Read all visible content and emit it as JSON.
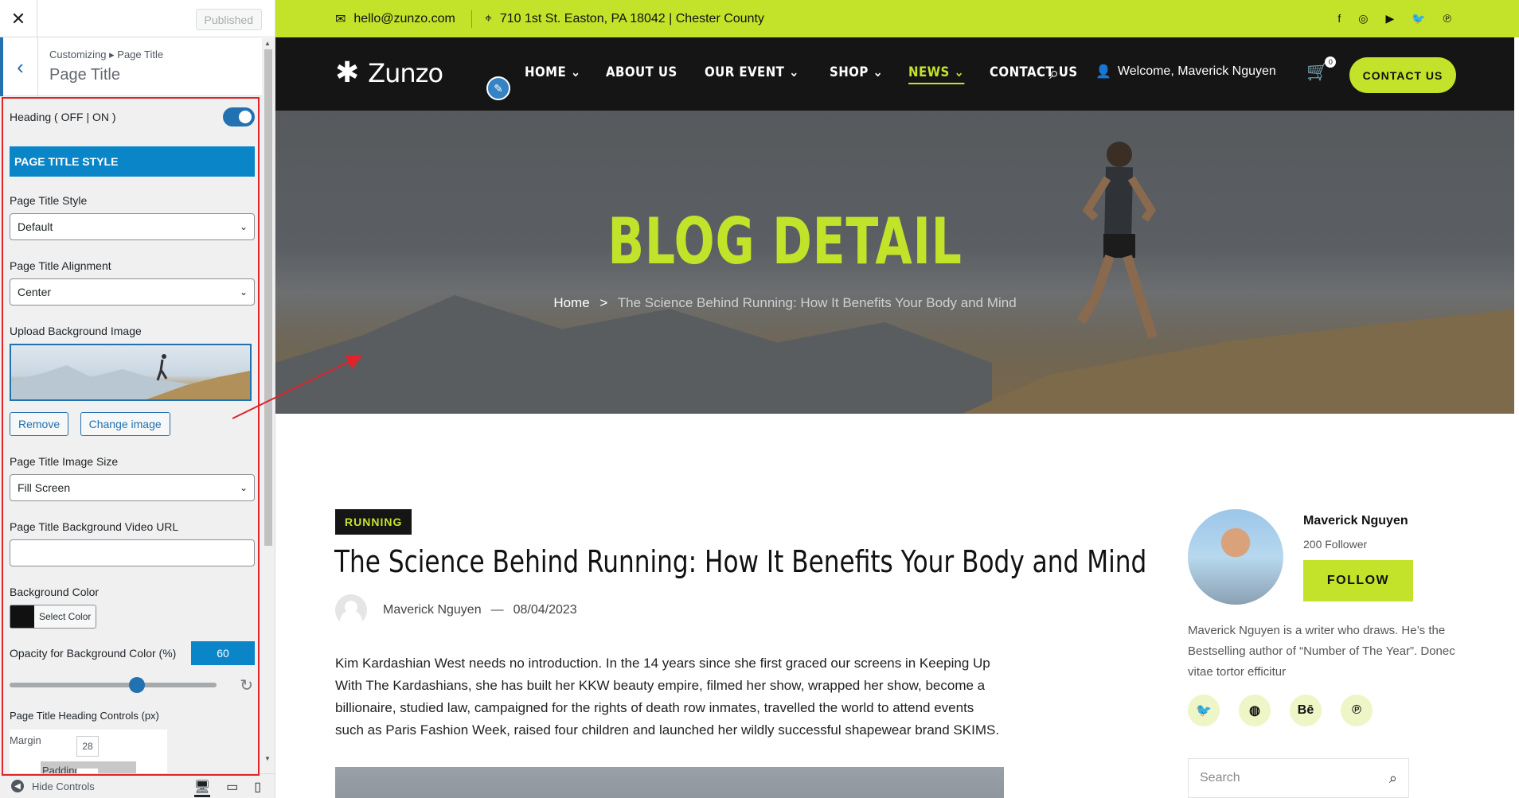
{
  "customizer": {
    "close_icon_glyph": "✕",
    "published_label": "Published",
    "breadcrumb": "Customizing ▸ Page Title",
    "section_title": "Page Title",
    "heading_toggle_label": "Heading ( OFF | ON )",
    "heading_toggle_on": true,
    "style_banner": "PAGE TITLE STYLE",
    "page_title_style_label": "Page Title Style",
    "page_title_style_value": "Default",
    "alignment_label": "Page Title Alignment",
    "alignment_value": "Center",
    "upload_bg_label": "Upload Background Image",
    "remove_label": "Remove",
    "change_image_label": "Change image",
    "image_size_label": "Page Title Image Size",
    "image_size_value": "Fill Screen",
    "video_url_label": "Page Title Background Video URL",
    "video_url_value": "",
    "bg_color_label": "Background Color",
    "bg_color_value": "#111111",
    "select_color_label": "Select Color",
    "opacity_label": "Opacity for Background Color (%)",
    "opacity_value": "60",
    "heading_controls_label": "Page Title Heading Controls (px)",
    "margin_label": "Margin",
    "margin_value": "28",
    "padding_label": "Padding",
    "padding_value": "-",
    "hide_controls_label": "Hide Controls"
  },
  "site": {
    "accent_color": "#c3e22a",
    "email": "hello@zunzo.com",
    "address": "710 1st St. Easton, PA 18042 | Chester County",
    "social_icons": [
      "facebook-icon",
      "instagram-icon",
      "youtube-icon",
      "twitter-icon",
      "pinterest-icon"
    ],
    "social_glyphs": [
      "f",
      "◎",
      "▶",
      "🐦",
      "℗"
    ],
    "logo_text": "Zunzo",
    "menu": [
      {
        "label": "HOME",
        "dropdown": true
      },
      {
        "label": "ABOUT US",
        "dropdown": false
      },
      {
        "label": "OUR EVENT",
        "dropdown": true
      },
      {
        "label": "SHOP",
        "dropdown": true
      },
      {
        "label": "NEWS",
        "dropdown": true,
        "active": true
      },
      {
        "label": "CONTACT US",
        "dropdown": false
      }
    ],
    "welcome_text": "Welcome, Maverick Nguyen",
    "cart_count": "0",
    "contact_button": "CONTACT US"
  },
  "hero": {
    "title": "BLOG DETAIL",
    "crumb_home": "Home",
    "crumb_sep": ">",
    "crumb_current": "The Science Behind Running: How It Benefits Your Body and Mind"
  },
  "post": {
    "tag": "RUNNING",
    "title": "The Science Behind Running: How It Benefits Your Body and Mind",
    "author": "Maverick Nguyen",
    "date": "08/04/2023",
    "body": "Kim Kardashian West needs no introduction. In the 14 years since she first graced our screens in Keeping Up With The Kardashians, she has built her KKW beauty empire, filmed her show, wrapped her show, become a billionaire, studied law, campaigned for the rights of death row inmates, travelled the world to attend events such as Paris Fashion Week, raised four children and launched her wildly successful shapewear brand SKIMS."
  },
  "sidebar_widget": {
    "author_name": "Maverick Nguyen",
    "followers": "200 Follower",
    "follow_label": "FOLLOW",
    "bio": "Maverick Nguyen is a writer who draws. He’s the Bestselling author of “Number of The Year”. Donec vitae tortor efficitur",
    "social": [
      "twitter-icon",
      "dribbble-icon",
      "behance-icon",
      "pinterest-icon"
    ],
    "social_glyphs": [
      "🐦",
      "◍",
      "Bē",
      "℗"
    ],
    "search_placeholder": "Search"
  }
}
